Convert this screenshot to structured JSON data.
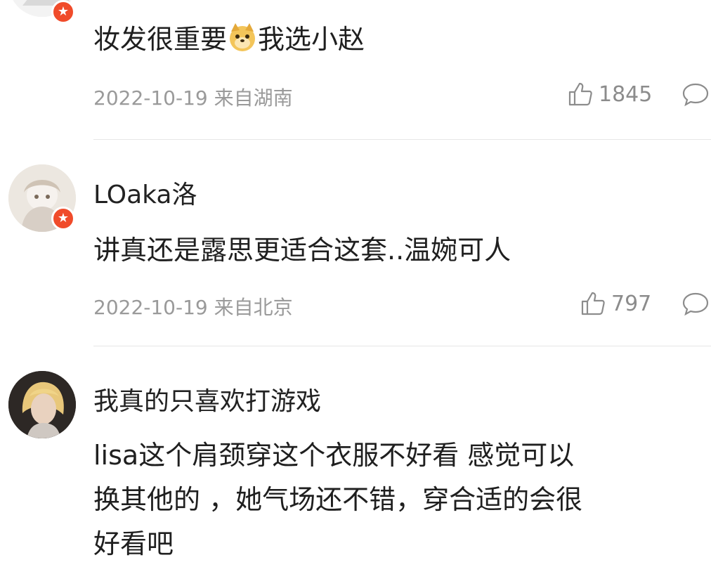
{
  "comments": [
    {
      "username": "",
      "text_before_emoji": "妆发很重要",
      "emoji": "doge-emoji",
      "text_after_emoji": "我选小赵",
      "date": "2022-10-19",
      "location": "来自湖南",
      "likes": "1845"
    },
    {
      "username": "LOaka洛",
      "text": "讲真还是露思更适合这套..温婉可人",
      "date": "2022-10-19",
      "location": "来自北京",
      "likes": "797"
    },
    {
      "username": "我真的只喜欢打游戏",
      "text_lines": [
        "lisa这个肩颈穿这个衣服不好看 感觉可以",
        "换其他的 ，她气场还不错，穿合适的会很",
        "好看吧"
      ]
    }
  ],
  "icons": {
    "like": "thumbs-up-icon",
    "reply": "comment-bubble-icon",
    "badge": "star-badge-icon"
  },
  "colors": {
    "badge": "#f04b2a",
    "meta_text": "#9a9a9a",
    "divider": "#e6e6e6"
  }
}
